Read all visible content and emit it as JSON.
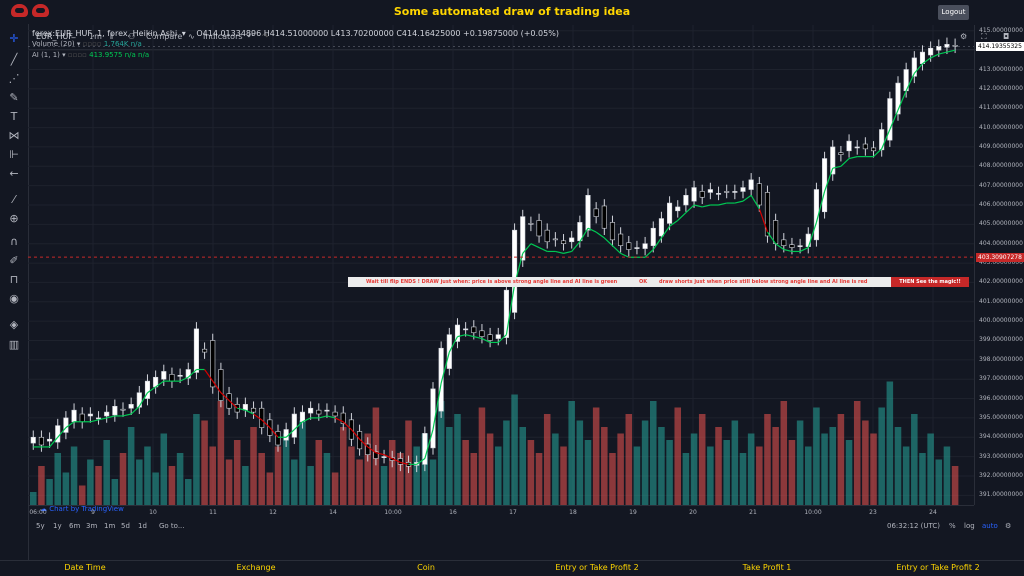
{
  "app": {
    "title": "Some automated draw of trading idea",
    "logout_label": "Logout"
  },
  "toolbar": {
    "symbol": "EUR_HUF",
    "interval": "1m",
    "compare_label": "Compare",
    "indicators_label": "Indicators"
  },
  "legend": {
    "main": "forex:EUR_HUF, 1, forex, Heikin Ashi",
    "ohlc": "O414.01334896  H414.51000000  L413.70200000  C414.16425000  +0.19875000 (+0.05%)",
    "volume_label": "Volume (20)",
    "volume_value": "1.764K  n/a",
    "ai_label": "AI (1, 1)",
    "ai_value": "413.9575  n/a  n/a"
  },
  "price_scale": {
    "ticks": [
      "415.00000000",
      "414.00000000",
      "413.00000000",
      "412.00000000",
      "411.00000000",
      "410.00000000",
      "409.00000000",
      "408.00000000",
      "407.00000000",
      "406.00000000",
      "405.00000000",
      "404.00000000",
      "403.00000000",
      "402.00000000",
      "401.00000000",
      "400.00000000",
      "399.00000000",
      "398.00000000",
      "397.00000000",
      "396.00000000",
      "395.00000000",
      "394.00000000",
      "393.00000000",
      "392.00000000",
      "391.00000000"
    ],
    "last_price": "414.19355325",
    "marker_price": "403.30907278"
  },
  "time_axis": {
    "labels": [
      "06:00",
      "9",
      "10",
      "11",
      "12",
      "14",
      "10:00",
      "16",
      "17",
      "18",
      "19",
      "20",
      "21",
      "10:00",
      "23",
      "24"
    ]
  },
  "banner": {
    "msg1": "Wait till flip ENDS ! DRAW just when: price is above strong angle line and AI line is green",
    "ok": "OK",
    "msg2": "draw shorts just when price still below strong angle line and AI line is red",
    "msg3": "THEN See the magic!!"
  },
  "watermark": "Chart by TradingView",
  "bottom_bar": {
    "ranges": [
      "5y",
      "1y",
      "6m",
      "3m",
      "1m",
      "5d",
      "1d"
    ],
    "goto": "Go to...",
    "clock": "06:32:12 (UTC)",
    "pct": "%",
    "log": "log",
    "auto": "auto"
  },
  "footer": {
    "labels": [
      "Date Time",
      "Exchange",
      "Coin",
      "Entry or Take Profit 2",
      "Take Profit 1",
      "Entry or Take Profit 2"
    ]
  },
  "colors": {
    "background": "#131722",
    "up": "#ffffff",
    "down": "#000000",
    "volume_up": "#26a69a",
    "volume_down": "#ef5350",
    "ai_green": "#00c853",
    "ai_red": "#d50000",
    "accent_yellow": "#ffd600",
    "marker_red": "#c62828"
  },
  "chart_data": {
    "type": "candlestick",
    "title": "forex:EUR_HUF, 1, forex, Heikin Ashi",
    "ylim": [
      390.5,
      415.3
    ],
    "series": [
      {
        "name": "EUR_HUF",
        "values": [
          394.0,
          393.6,
          393.9,
          394.6,
          395.0,
          395.4,
          394.8,
          395.2,
          395.0,
          395.3,
          395.6,
          395.4,
          395.7,
          396.3,
          396.9,
          397.1,
          397.4,
          396.9,
          397.2,
          397.5,
          399.6,
          398.4,
          396.6,
          395.9,
          395.5,
          395.3,
          395.7,
          395.3,
          394.5,
          394.1,
          393.6,
          394.4,
          395.2,
          395.3,
          395.5,
          395.2,
          395.4,
          395.1,
          394.7,
          393.9,
          393.4,
          393.1,
          392.9,
          393.0,
          392.8,
          392.6,
          392.5,
          392.7,
          394.2,
          396.5,
          398.6,
          399.3,
          399.8,
          399.6,
          399.4,
          399.2,
          399.0,
          399.3,
          401.6,
          404.7,
          405.4,
          405.0,
          404.4,
          404.1,
          404.2,
          404.0,
          404.3,
          405.1,
          406.5,
          405.4,
          404.8,
          404.2,
          403.9,
          403.7,
          403.8,
          404.0,
          404.8,
          405.3,
          406.1,
          405.9,
          406.5,
          406.9,
          406.4,
          406.8,
          406.6,
          406.7,
          406.7,
          406.9,
          407.3,
          406.0,
          404.4,
          404.0,
          403.9,
          403.8,
          403.9,
          404.5,
          406.8,
          408.4,
          409.0,
          408.6,
          409.3,
          409.0,
          408.9,
          408.8,
          409.9,
          411.5,
          412.3,
          413.0,
          413.6,
          413.9,
          414.1,
          414.2,
          414.3,
          414.2
        ]
      },
      {
        "name": "AI",
        "values": [
          393.5,
          393.5,
          393.5,
          394.0,
          394.5,
          394.8,
          394.8,
          394.8,
          394.9,
          395.0,
          395.1,
          395.1,
          395.2,
          395.6,
          396.3,
          396.6,
          396.9,
          396.9,
          396.9,
          397.1,
          397.5,
          397.5,
          396.9,
          396.3,
          395.9,
          395.5,
          395.4,
          395.2,
          394.9,
          394.5,
          394.0,
          394.0,
          394.4,
          394.8,
          395.0,
          395.0,
          395.1,
          395.0,
          394.8,
          394.4,
          393.9,
          393.5,
          393.2,
          393.1,
          392.9,
          392.7,
          392.6,
          392.6,
          392.9,
          394.4,
          396.8,
          398.4,
          399.2,
          399.3,
          399.2,
          399.1,
          398.9,
          398.9,
          399.3,
          401.9,
          403.5,
          404.0,
          403.8,
          403.6,
          403.6,
          403.5,
          403.6,
          404.1,
          404.8,
          404.6,
          404.3,
          403.9,
          403.5,
          403.3,
          403.3,
          403.3,
          403.7,
          404.3,
          404.9,
          405.2,
          405.6,
          406.0,
          405.9,
          406.0,
          406.0,
          406.1,
          406.1,
          406.2,
          406.5,
          405.8,
          404.6,
          404.0,
          403.7,
          403.6,
          403.6,
          403.8,
          405.1,
          406.7,
          407.9,
          408.0,
          408.4,
          408.5,
          408.5,
          408.5,
          408.9,
          409.9,
          410.9,
          411.9,
          412.8,
          413.3,
          413.6,
          413.8,
          413.9,
          414.0
        ]
      },
      {
        "name": "Volume (20)",
        "values": [
          2,
          6,
          4,
          8,
          5,
          9,
          3,
          7,
          6,
          10,
          4,
          8,
          12,
          7,
          9,
          5,
          11,
          6,
          8,
          4,
          14,
          13,
          9,
          16,
          7,
          10,
          6,
          12,
          8,
          5,
          9,
          11,
          7,
          13,
          6,
          10,
          8,
          5,
          12,
          9,
          7,
          11,
          15,
          6,
          10,
          8,
          13,
          9,
          11,
          7,
          16,
          12,
          14,
          10,
          8,
          15,
          11,
          9,
          13,
          17,
          12,
          10,
          8,
          14,
          11,
          9,
          16,
          13,
          10,
          15,
          12,
          8,
          11,
          14,
          9,
          13,
          16,
          12,
          10,
          15,
          8,
          11,
          14,
          9,
          12,
          10,
          13,
          8,
          11,
          9,
          14,
          12,
          16,
          10,
          13,
          9,
          15,
          11,
          12,
          14,
          10,
          16,
          13,
          11,
          15,
          19,
          12,
          9,
          14,
          8,
          11,
          7,
          9,
          6
        ]
      }
    ]
  }
}
